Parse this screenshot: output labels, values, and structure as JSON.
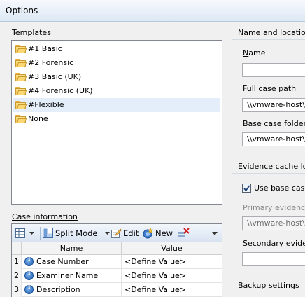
{
  "window": {
    "title": "Options"
  },
  "templates": {
    "label": "Templates",
    "items": [
      "#1 Basic",
      "#2 Forensic",
      "#3 Basic (UK)",
      "#4 Forensic (UK)",
      "#Flexible",
      "None"
    ],
    "selected_index": 4
  },
  "case_info": {
    "label": "Case information",
    "toolbar": {
      "split_mode": "Split Mode",
      "edit": "Edit",
      "new": "New"
    },
    "columns": [
      "Name",
      "Value"
    ],
    "rows": [
      {
        "num": "1",
        "name": "Case Number",
        "value": "<Define Value>"
      },
      {
        "num": "2",
        "name": "Examiner Name",
        "value": "<Define Value>"
      },
      {
        "num": "3",
        "name": "Description",
        "value": "<Define Value>"
      }
    ]
  },
  "name_location": {
    "header": "Name and location",
    "name_label": "Name",
    "name_value": "",
    "full_path_label": "Full case path",
    "full_path_value": "\\\\vmware-host\\",
    "base_folder_label": "Base case folder",
    "base_folder_value": "\\\\vmware-host\\"
  },
  "evidence_cache": {
    "header": "Evidence cache lo",
    "use_base_label": "Use base case",
    "use_base_checked": true,
    "primary_label": "Primary evidence",
    "primary_value": "\\\\vmware-host\\",
    "secondary_label": "Secondary evider",
    "secondary_value": ""
  },
  "backup": {
    "header": "Backup settings"
  }
}
